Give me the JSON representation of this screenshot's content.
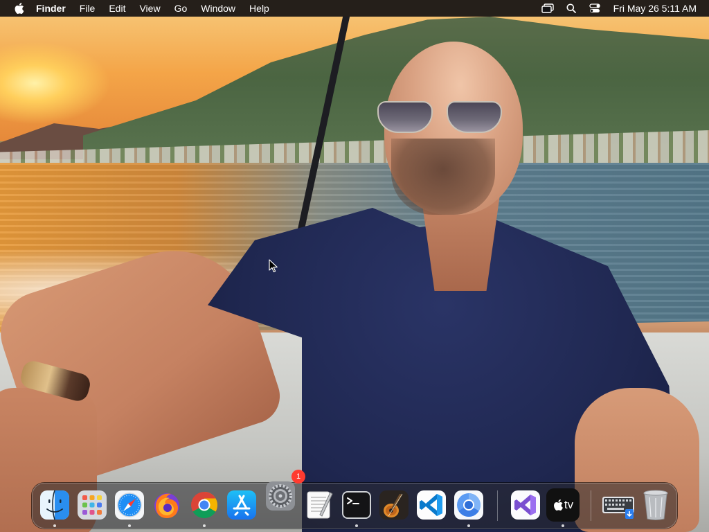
{
  "menubar": {
    "app_name": "Finder",
    "menus": [
      "File",
      "Edit",
      "View",
      "Go",
      "Window",
      "Help"
    ],
    "status_icons": [
      "screen-mirroring-icon",
      "spotlight-search-icon",
      "control-center-icon"
    ],
    "clock": "Fri May 26  5:11 AM"
  },
  "dock": {
    "apps": [
      {
        "name": "Finder",
        "icon": "finder-icon",
        "running": true
      },
      {
        "name": "Launchpad",
        "icon": "launchpad-icon",
        "running": false
      },
      {
        "name": "Safari",
        "icon": "safari-icon",
        "running": true
      },
      {
        "name": "Firefox",
        "icon": "firefox-icon",
        "running": false
      },
      {
        "name": "Google Chrome",
        "icon": "chrome-icon",
        "running": true
      },
      {
        "name": "App Store",
        "icon": "app-store-icon",
        "running": false
      },
      {
        "name": "System Preferences",
        "icon": "system-preferences-icon",
        "running": false,
        "badge": "1"
      },
      {
        "name": "TextEdit",
        "icon": "textedit-icon",
        "running": false
      },
      {
        "name": "Terminal",
        "icon": "terminal-icon",
        "running": true
      },
      {
        "name": "GarageBand",
        "icon": "garageband-icon",
        "running": false
      },
      {
        "name": "Visual Studio Code",
        "icon": "vscode-icon",
        "running": false
      },
      {
        "name": "Chromium",
        "icon": "chromium-icon",
        "running": true
      },
      {
        "name": "Visual Studio",
        "icon": "visual-studio-icon",
        "running": false
      },
      {
        "name": "Apple TV",
        "icon": "apple-tv-icon",
        "label": "tv",
        "running": true
      },
      {
        "name": "Downloads",
        "icon": "downloads-stack-icon",
        "running": false
      },
      {
        "name": "Trash",
        "icon": "trash-icon",
        "running": false
      }
    ]
  },
  "colors": {
    "menubar_bg": "#141416",
    "badge": "#ff3b30",
    "vscode_blue": "#0a7acc",
    "vs_purple": "#7a4fd0"
  }
}
